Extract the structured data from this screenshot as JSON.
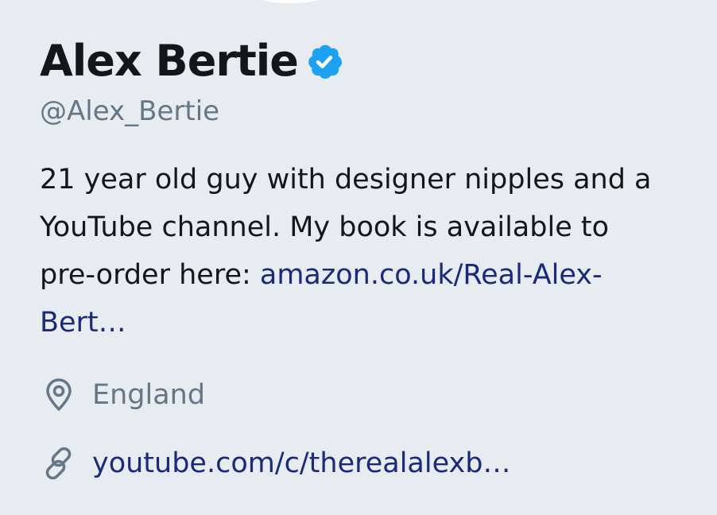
{
  "profile": {
    "name": "Alex Bertie",
    "handle": "@Alex_Bertie",
    "verified_icon": "verified-badge-icon",
    "bio_text": "21 year old guy with designer nipples and a YouTube channel. My book is available to pre-order here: ",
    "bio_link": "amazon.co.uk/Real-Alex-Bert…",
    "location": "England",
    "website": "youtube.com/c/therealalexb…"
  },
  "icons": {
    "location": "location-pin-icon",
    "website": "link-icon"
  },
  "colors": {
    "background": "#e6ecf0",
    "verified": "#1da1f2",
    "link": "#1b2a78",
    "muted": "#657786"
  }
}
